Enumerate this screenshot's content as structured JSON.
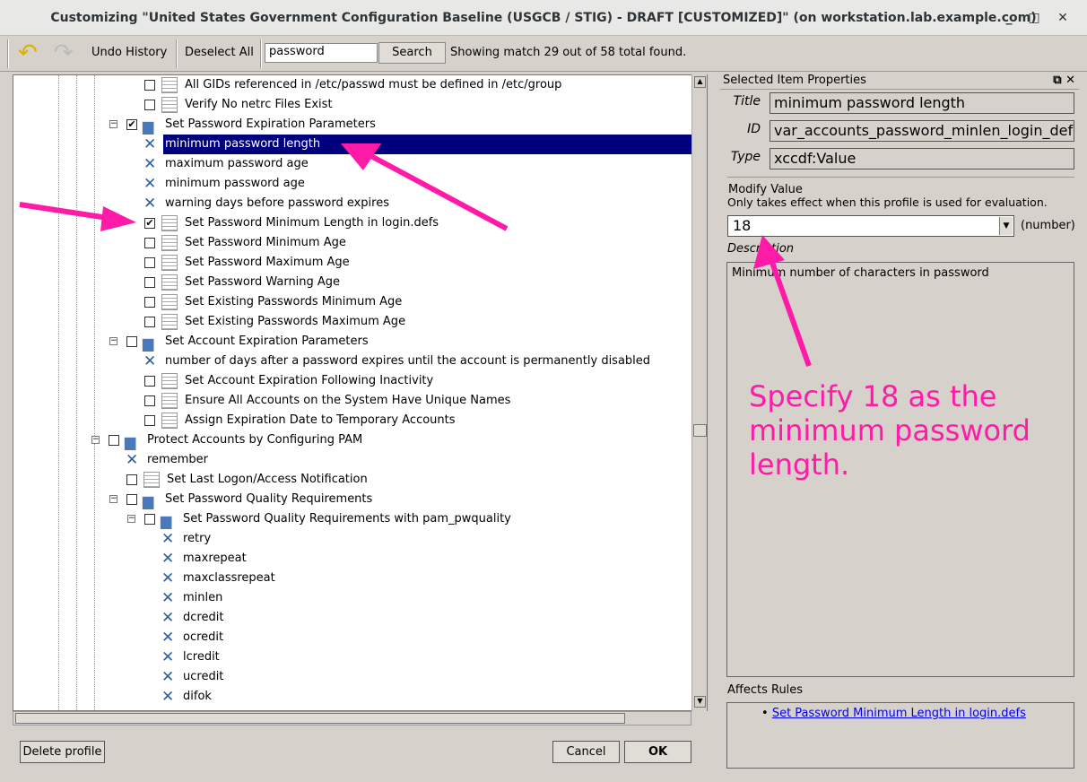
{
  "window": {
    "title": "Customizing \"United States Government Configuration Baseline (USGCB / STIG) - DRAFT [CUSTOMIZED]\" (on workstation.lab.example.com)",
    "minimize": "_",
    "maximize": "□",
    "close": "✕"
  },
  "toolbar": {
    "undo_history": "Undo History",
    "deselect_all": "Deselect All",
    "search_value": "password",
    "search_button": "Search",
    "status": "Showing match 29 out of 58 total found."
  },
  "tree": [
    {
      "type": "rule",
      "depth": 3,
      "label": "All GIDs referenced in /etc/passwd must be defined in /etc/group",
      "checked": false
    },
    {
      "type": "rule",
      "depth": 3,
      "label": "Verify No netrc Files Exist",
      "checked": false
    },
    {
      "type": "group",
      "depth": 2,
      "label": "Set Password Expiration Parameters",
      "checked": true
    },
    {
      "type": "value",
      "depth": 3,
      "label": "minimum password length",
      "selected": true
    },
    {
      "type": "value",
      "depth": 3,
      "label": "maximum password age"
    },
    {
      "type": "value",
      "depth": 3,
      "label": "minimum password age"
    },
    {
      "type": "value",
      "depth": 3,
      "label": "warning days before password expires"
    },
    {
      "type": "rule",
      "depth": 3,
      "label": "Set Password Minimum Length in login.defs",
      "checked": true
    },
    {
      "type": "rule",
      "depth": 3,
      "label": "Set Password Minimum Age",
      "checked": false
    },
    {
      "type": "rule",
      "depth": 3,
      "label": "Set Password Maximum Age",
      "checked": false
    },
    {
      "type": "rule",
      "depth": 3,
      "label": "Set Password Warning Age",
      "checked": false
    },
    {
      "type": "rule",
      "depth": 3,
      "label": "Set Existing Passwords Minimum Age",
      "checked": false
    },
    {
      "type": "rule",
      "depth": 3,
      "label": "Set Existing Passwords Maximum Age",
      "checked": false
    },
    {
      "type": "group",
      "depth": 2,
      "label": "Set Account Expiration Parameters",
      "checked": false
    },
    {
      "type": "value",
      "depth": 3,
      "label": "number of days after a password expires until the account is permanently disabled"
    },
    {
      "type": "rule",
      "depth": 3,
      "label": "Set Account Expiration Following Inactivity",
      "checked": false
    },
    {
      "type": "rule",
      "depth": 3,
      "label": "Ensure All Accounts on the System Have Unique Names",
      "checked": false
    },
    {
      "type": "rule",
      "depth": 3,
      "label": "Assign Expiration Date to Temporary Accounts",
      "checked": false
    },
    {
      "type": "group",
      "depth": 1,
      "label": "Protect Accounts by Configuring PAM",
      "checked": false
    },
    {
      "type": "value",
      "depth": 2,
      "label": "remember"
    },
    {
      "type": "rule",
      "depth": 2,
      "label": "Set Last Logon/Access Notification",
      "checked": false
    },
    {
      "type": "group",
      "depth": 2,
      "label": "Set Password Quality Requirements",
      "checked": false
    },
    {
      "type": "group",
      "depth": 3,
      "label": "Set Password Quality Requirements with pam_pwquality",
      "checked": false
    },
    {
      "type": "value",
      "depth": 4,
      "label": "retry"
    },
    {
      "type": "value",
      "depth": 4,
      "label": "maxrepeat"
    },
    {
      "type": "value",
      "depth": 4,
      "label": "maxclassrepeat"
    },
    {
      "type": "value",
      "depth": 4,
      "label": "minlen"
    },
    {
      "type": "value",
      "depth": 4,
      "label": "dcredit"
    },
    {
      "type": "value",
      "depth": 4,
      "label": "ocredit"
    },
    {
      "type": "value",
      "depth": 4,
      "label": "lcredit"
    },
    {
      "type": "value",
      "depth": 4,
      "label": "ucredit"
    },
    {
      "type": "value",
      "depth": 4,
      "label": "difok"
    }
  ],
  "buttons": {
    "delete_profile": "Delete profile",
    "cancel": "Cancel",
    "ok": "OK"
  },
  "panel": {
    "header": "Selected Item Properties",
    "title_label": "Title",
    "title": "minimum password length",
    "id_label": "ID",
    "id": "var_accounts_password_minlen_login_defs",
    "type_label": "Type",
    "type": "xccdf:Value",
    "modify_value": "Modify Value",
    "modify_note": "Only takes effect when this profile is used for evaluation.",
    "value": "18",
    "value_type": "(number)",
    "description_label": "Description",
    "description": "Minimum number of characters in password",
    "affects_rules_label": "Affects Rules",
    "affects_rules": [
      "Set Password Minimum Length in login.defs"
    ]
  },
  "annotation": {
    "text": "Specify 18 as the minimum password length.",
    "color": "#ff1aa8"
  }
}
